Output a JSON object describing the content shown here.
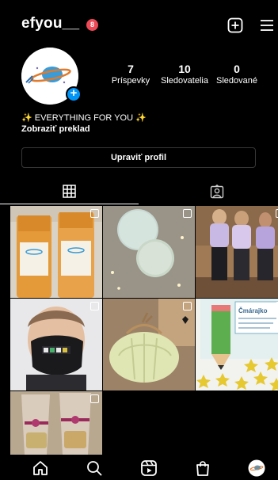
{
  "header": {
    "username": "efyou__",
    "notification_count": "8"
  },
  "profile": {
    "stats": [
      {
        "value": "7",
        "label": "Príspevky"
      },
      {
        "value": "10",
        "label": "Sledovatelia"
      },
      {
        "value": "0",
        "label": "Sledované"
      }
    ],
    "bio": {
      "line1": "✨ EVERYTHING FOR YOU ✨",
      "translate": "Zobraziť preklad"
    },
    "edit_button": "Upraviť profil"
  },
  "tabs": [
    "grid-icon",
    "tagged-icon"
  ],
  "posts": [
    {
      "name": "post-serum-bottles",
      "multi": true
    },
    {
      "name": "post-round-soaps",
      "multi": true
    },
    {
      "name": "post-people-face-masks",
      "multi": true
    },
    {
      "name": "post-boy-face-mask",
      "multi": true
    },
    {
      "name": "post-pumpkin-soap",
      "multi": true
    },
    {
      "name": "post-pencil-card",
      "multi": true
    },
    {
      "name": "post-gift-bags",
      "multi": true
    }
  ],
  "nav": [
    "home-icon",
    "search-icon",
    "reels-icon",
    "shop-icon",
    "profile-avatar"
  ],
  "colors": {
    "background": "#000000",
    "badge": "#ed4956",
    "accent": "#0095f6",
    "border": "#363636"
  }
}
